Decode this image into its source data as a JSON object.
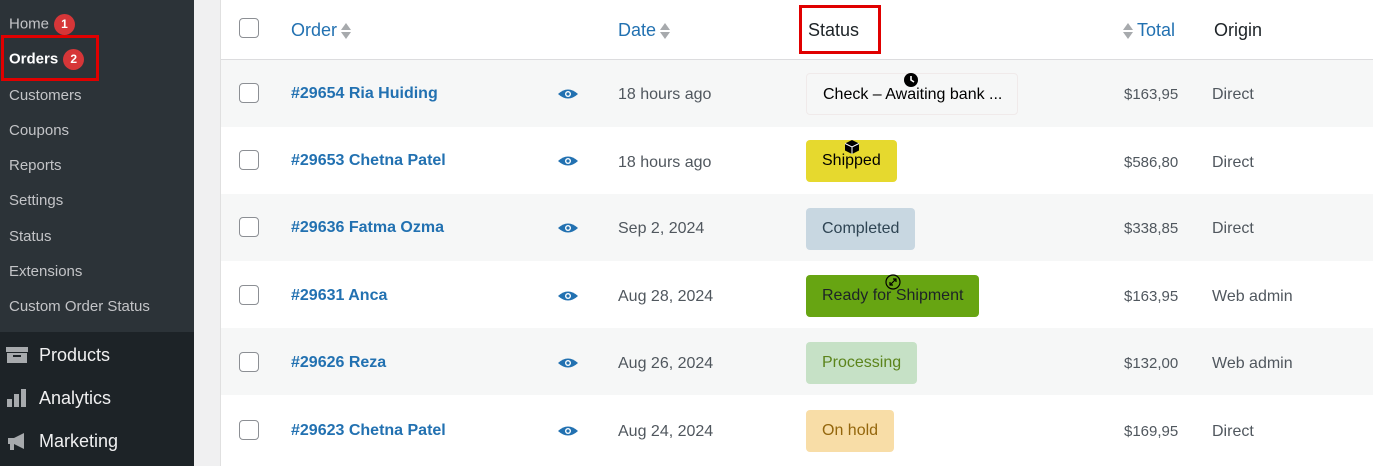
{
  "sidebar": {
    "submenu": [
      {
        "label": "Home",
        "badge": "1"
      },
      {
        "label": "Orders",
        "badge": "2"
      },
      {
        "label": "Customers"
      },
      {
        "label": "Coupons"
      },
      {
        "label": "Reports"
      },
      {
        "label": "Settings"
      },
      {
        "label": "Status"
      },
      {
        "label": "Extensions"
      },
      {
        "label": "Custom Order Status"
      }
    ],
    "main": [
      {
        "label": "Products",
        "icon": "archive-icon"
      },
      {
        "label": "Analytics",
        "icon": "bar-chart-icon"
      },
      {
        "label": "Marketing",
        "icon": "megaphone-icon"
      }
    ]
  },
  "table": {
    "headers": {
      "order": "Order",
      "date": "Date",
      "status": "Status",
      "total": "Total",
      "origin": "Origin"
    },
    "rows": [
      {
        "order": "#29654 Ria Huiding",
        "date": "18 hours ago",
        "status": "Check – Awaiting bank ...",
        "total": "$163,95",
        "origin": "Direct",
        "status_bg": "#f8f3f3",
        "status_fg": "#1d2327"
      },
      {
        "order": "#29653 Chetna Patel",
        "date": "18 hours ago",
        "status": "Shipped",
        "total": "$586,80",
        "origin": "Direct",
        "status_bg": "#e6d92e",
        "status_fg": "#1d2327"
      },
      {
        "order": "#29636 Fatma Ozma",
        "date": "Sep 2, 2024",
        "status": "Completed",
        "total": "$338,85",
        "origin": "Direct",
        "status_bg": "#c8d7e1",
        "status_fg": "#2e4453"
      },
      {
        "order": "#29631 Anca",
        "date": "Aug 28, 2024",
        "status": "Ready for Shipment",
        "total": "$163,95",
        "origin": "Web admin",
        "status_bg": "#67a512",
        "status_fg": "#1d2327"
      },
      {
        "order": "#29626 Reza",
        "date": "Aug 26, 2024",
        "status": "Processing",
        "total": "$132,00",
        "origin": "Web admin",
        "status_bg": "#c6e1c6",
        "status_fg": "#5b841b"
      },
      {
        "order": "#29623 Chetna Patel",
        "date": "Aug 24, 2024",
        "status": "On hold",
        "total": "$169,95",
        "origin": "Direct",
        "status_bg": "#f8dda7",
        "status_fg": "#94660c"
      }
    ]
  },
  "colors": {
    "link": "#2271b1",
    "highlight": "#e00000",
    "badge": "#d63638"
  }
}
